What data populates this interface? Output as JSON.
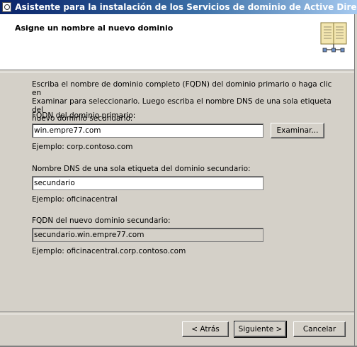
{
  "window": {
    "title": "Asistente para la instalación de los Servicios de dominio de Active Directory",
    "icon": "ad-wizard-icon"
  },
  "header": {
    "title": "Asigne un nombre al nuevo dominio",
    "icon": "book-directory-icon"
  },
  "content": {
    "instructions_line1": "Escriba el nombre de dominio completo (FQDN) del dominio primario o haga clic en",
    "instructions_line2": "Examinar para seleccionarlo. Luego escriba el nombre DNS de una sola etiqueta del",
    "instructions_line3": "nuevo dominio secundario.",
    "parent_fqdn_label": "FQDN del dominio primario:",
    "parent_fqdn_value": "win.empre77.com",
    "browse_button": "Examinar...",
    "parent_example": "Ejemplo: corp.contoso.com",
    "child_dns_label": "Nombre DNS de una sola etiqueta del dominio secundario:",
    "child_dns_value": "secundario",
    "child_example": "Ejemplo: oficinacentral",
    "new_fqdn_label": "FQDN del nuevo dominio secundario:",
    "new_fqdn_value": "secundario.win.empre77.com",
    "new_fqdn_example": "Ejemplo: oficinacentral.corp.contoso.com"
  },
  "footer": {
    "back_button": "< Atrás",
    "next_button": "Siguiente >",
    "cancel_button": "Cancelar"
  }
}
